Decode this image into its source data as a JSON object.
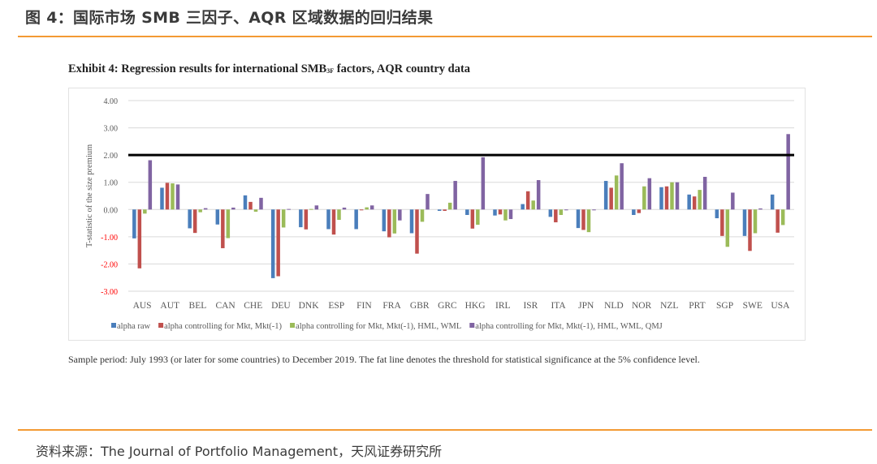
{
  "figure": {
    "title": "图 4：国际市场 SMB 三因子、AQR 区域数据的回归结果",
    "exhibit_title_main": "Exhibit 4: Regression results for international SMB",
    "exhibit_title_sub": "3F",
    "exhibit_title_tail": " factors, AQR country data",
    "note": "Sample period: July 1993 (or later for some countries) to December 2019. The fat line denotes the threshold for statistical significance at the 5% confidence level.",
    "source": "资料来源：The Journal of Portfolio Management，天风证券研究所"
  },
  "colors": {
    "accent_rule": "#f39a34",
    "threshold_line": "#000000",
    "negative_tick_label": "#ff0000"
  },
  "chart_data": {
    "type": "bar",
    "title": "Regression results for international SMB3F factors, AQR country data",
    "xlabel": "",
    "ylabel": "T-statistic of the size premium",
    "ylim": [
      -3,
      4
    ],
    "yticks": [
      4,
      3,
      2,
      1,
      0,
      -1,
      -2,
      -3
    ],
    "ytick_labels": [
      "4.00",
      "3.00",
      "2.00",
      "1.00",
      "0.00",
      "-1.00",
      "-2.00",
      "-3.00"
    ],
    "grid": true,
    "legend_position": "bottom",
    "threshold": {
      "value": 2.0,
      "label": "5% significance threshold"
    },
    "categories": [
      "AUS",
      "AUT",
      "BEL",
      "CAN",
      "CHE",
      "DEU",
      "DNK",
      "ESP",
      "FIN",
      "FRA",
      "GBR",
      "GRC",
      "HKG",
      "IRL",
      "ISR",
      "ITA",
      "JPN",
      "NLD",
      "NOR",
      "NZL",
      "PRT",
      "SGP",
      "SWE",
      "USA"
    ],
    "series": [
      {
        "name": "alpha raw",
        "color": "#4a7ebb",
        "values": [
          -1.06,
          0.8,
          -0.69,
          -0.55,
          0.52,
          -2.52,
          -0.65,
          -0.72,
          -0.72,
          -0.8,
          -0.87,
          -0.05,
          -0.2,
          -0.22,
          0.2,
          -0.27,
          -0.68,
          1.05,
          -0.2,
          0.82,
          0.55,
          -0.32,
          -0.97,
          0.55
        ]
      },
      {
        "name": "alpha controlling for Mkt, Mkt(-1)",
        "color": "#c0504d",
        "values": [
          -2.16,
          0.98,
          -0.86,
          -1.42,
          0.28,
          -2.45,
          -0.73,
          -0.92,
          -0.02,
          -1.02,
          -1.62,
          -0.05,
          -0.7,
          -0.18,
          0.67,
          -0.47,
          -0.75,
          0.8,
          -0.13,
          0.85,
          0.48,
          -0.97,
          -1.52,
          -0.85
        ]
      },
      {
        "name": "alpha controlling for Mkt, Mkt(-1), HML, WML",
        "color": "#9bbb59",
        "values": [
          -0.15,
          0.96,
          -0.1,
          -1.05,
          -0.08,
          -0.66,
          0.02,
          -0.38,
          0.08,
          -0.88,
          -0.45,
          0.25,
          -0.56,
          -0.4,
          0.33,
          -0.2,
          -0.83,
          1.25,
          0.85,
          1.0,
          0.72,
          -1.37,
          -0.87,
          -0.57
        ]
      },
      {
        "name": "alpha controlling for Mkt, Mkt(-1), HML, WML, QMJ",
        "color": "#8064a2",
        "values": [
          1.81,
          0.92,
          0.05,
          0.07,
          0.43,
          0.02,
          0.15,
          0.07,
          0.15,
          -0.4,
          0.57,
          1.05,
          1.92,
          -0.35,
          1.08,
          -0.02,
          -0.03,
          1.7,
          1.15,
          1.0,
          1.2,
          0.62,
          0.04,
          2.77
        ]
      }
    ]
  }
}
